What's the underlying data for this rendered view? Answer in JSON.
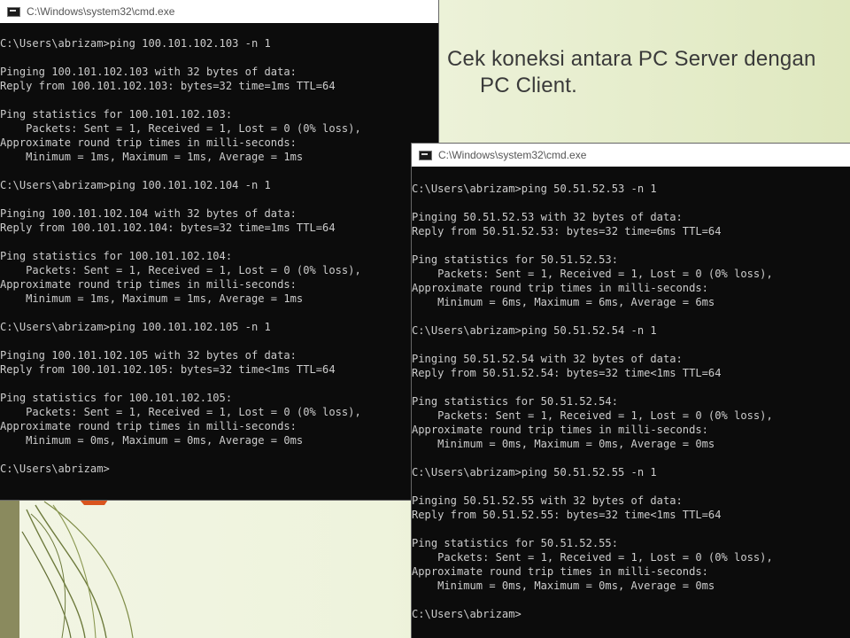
{
  "slide": {
    "caption_line1": "Cek koneksi antara PC Server dengan",
    "caption_line2": "PC Client."
  },
  "windows": {
    "left": {
      "title": "C:\\Windows\\system32\\cmd.exe",
      "lines": [
        "C:\\Users\\abrizam>ping 100.101.102.103 -n 1",
        "",
        "Pinging 100.101.102.103 with 32 bytes of data:",
        "Reply from 100.101.102.103: bytes=32 time=1ms TTL=64",
        "",
        "Ping statistics for 100.101.102.103:",
        "    Packets: Sent = 1, Received = 1, Lost = 0 (0% loss),",
        "Approximate round trip times in milli-seconds:",
        "    Minimum = 1ms, Maximum = 1ms, Average = 1ms",
        "",
        "C:\\Users\\abrizam>ping 100.101.102.104 -n 1",
        "",
        "Pinging 100.101.102.104 with 32 bytes of data:",
        "Reply from 100.101.102.104: bytes=32 time=1ms TTL=64",
        "",
        "Ping statistics for 100.101.102.104:",
        "    Packets: Sent = 1, Received = 1, Lost = 0 (0% loss),",
        "Approximate round trip times in milli-seconds:",
        "    Minimum = 1ms, Maximum = 1ms, Average = 1ms",
        "",
        "C:\\Users\\abrizam>ping 100.101.102.105 -n 1",
        "",
        "Pinging 100.101.102.105 with 32 bytes of data:",
        "Reply from 100.101.102.105: bytes=32 time<1ms TTL=64",
        "",
        "Ping statistics for 100.101.102.105:",
        "    Packets: Sent = 1, Received = 1, Lost = 0 (0% loss),",
        "Approximate round trip times in milli-seconds:",
        "    Minimum = 0ms, Maximum = 0ms, Average = 0ms",
        "",
        "C:\\Users\\abrizam>"
      ]
    },
    "right": {
      "title": "C:\\Windows\\system32\\cmd.exe",
      "lines": [
        "C:\\Users\\abrizam>ping 50.51.52.53 -n 1",
        "",
        "Pinging 50.51.52.53 with 32 bytes of data:",
        "Reply from 50.51.52.53: bytes=32 time=6ms TTL=64",
        "",
        "Ping statistics for 50.51.52.53:",
        "    Packets: Sent = 1, Received = 1, Lost = 0 (0% loss),",
        "Approximate round trip times in milli-seconds:",
        "    Minimum = 6ms, Maximum = 6ms, Average = 6ms",
        "",
        "C:\\Users\\abrizam>ping 50.51.52.54 -n 1",
        "",
        "Pinging 50.51.52.54 with 32 bytes of data:",
        "Reply from 50.51.52.54: bytes=32 time<1ms TTL=64",
        "",
        "Ping statistics for 50.51.52.54:",
        "    Packets: Sent = 1, Received = 1, Lost = 0 (0% loss),",
        "Approximate round trip times in milli-seconds:",
        "    Minimum = 0ms, Maximum = 0ms, Average = 0ms",
        "",
        "C:\\Users\\abrizam>ping 50.51.52.55 -n 1",
        "",
        "Pinging 50.51.52.55 with 32 bytes of data:",
        "Reply from 50.51.52.55: bytes=32 time<1ms TTL=64",
        "",
        "Ping statistics for 50.51.52.55:",
        "    Packets: Sent = 1, Received = 1, Lost = 0 (0% loss),",
        "Approximate round trip times in milli-seconds:",
        "    Minimum = 0ms, Maximum = 0ms, Average = 0ms",
        "",
        "C:\\Users\\abrizam>"
      ]
    }
  },
  "colors": {
    "console_bg": "#0c0c0c",
    "console_text": "#cccccc",
    "slide_accent": "#8a8a5e",
    "slide_accent_orange": "#d9541e"
  },
  "icons": {
    "console_icon": "cmd-icon"
  }
}
